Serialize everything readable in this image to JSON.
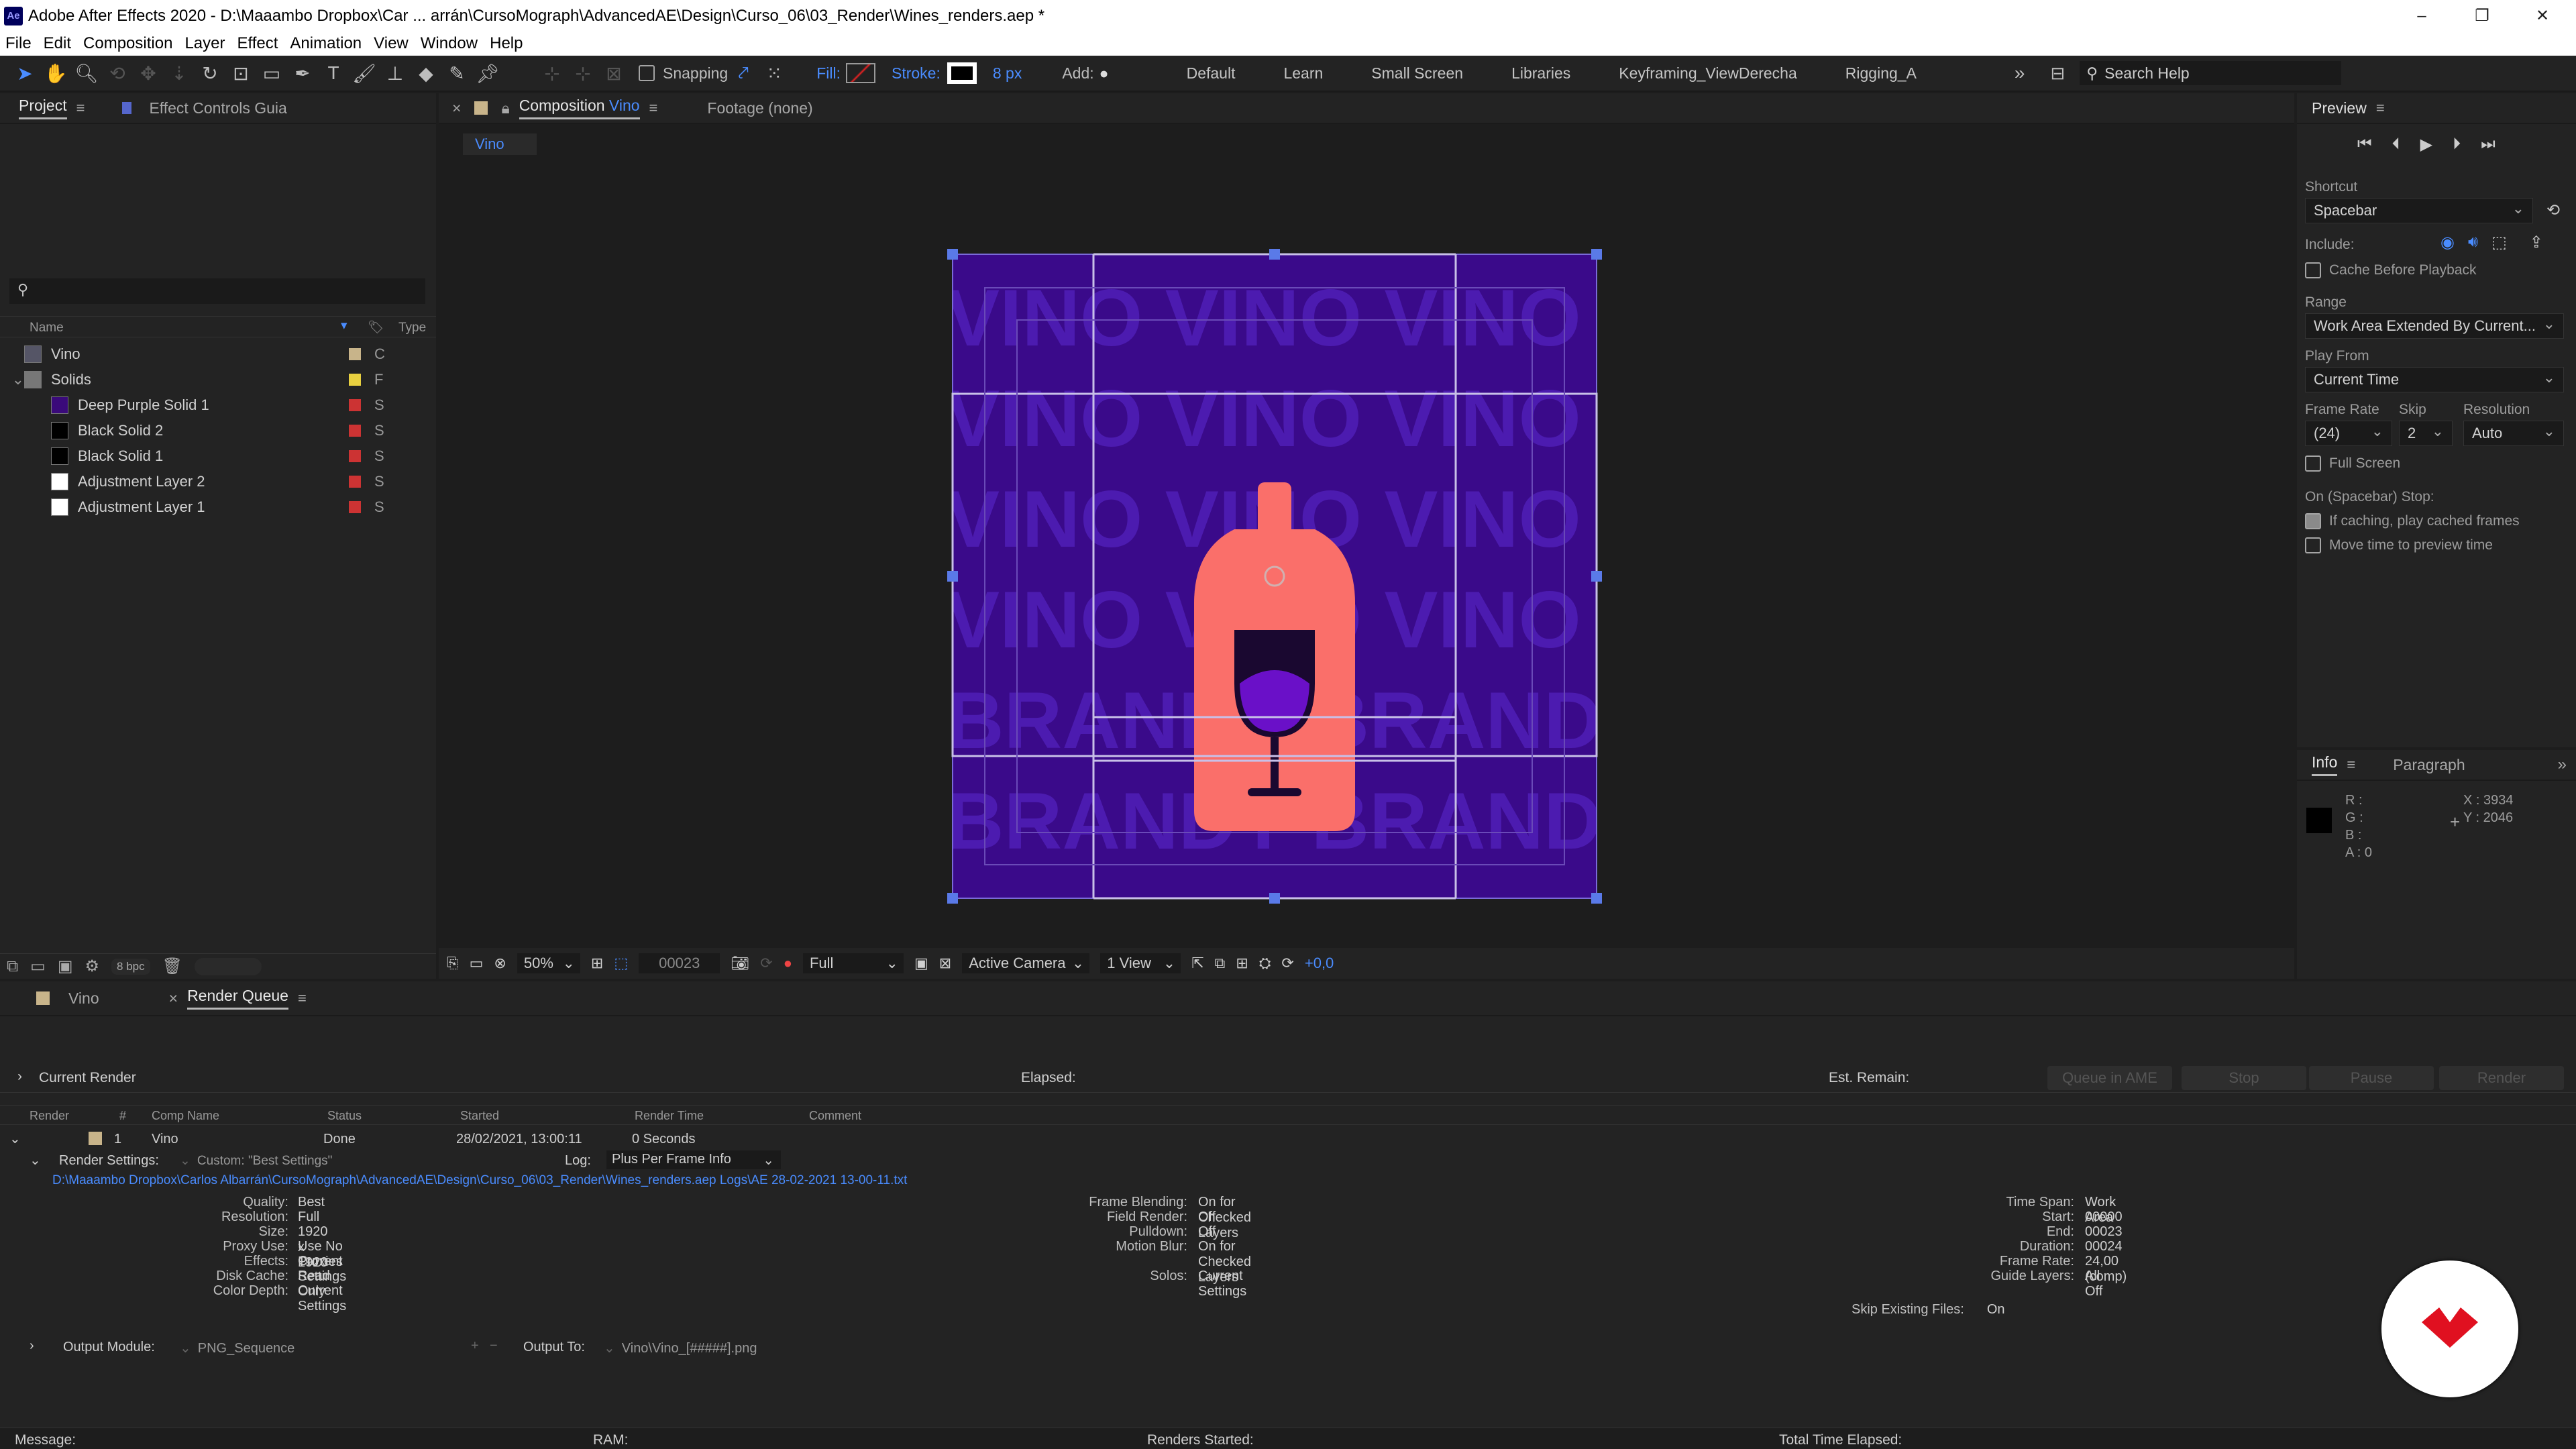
{
  "window": {
    "title": "Adobe After Effects 2020 - D:\\Maaambo Dropbox\\Car ... arrán\\CursoMograph\\AdvancedAE\\Design\\Curso_06\\03_Render\\Wines_renders.aep *",
    "logo": "Ae",
    "minimize": "–",
    "maximize": "❐",
    "close": "✕"
  },
  "menu": [
    "File",
    "Edit",
    "Composition",
    "Layer",
    "Effect",
    "Animation",
    "View",
    "Window",
    "Help"
  ],
  "toolbar": {
    "snapping": "Snapping",
    "fill": "Fill:",
    "stroke": "Stroke:",
    "stroke_px": "8 px",
    "add": "Add:",
    "workspaces": [
      "Default",
      "Learn",
      "Small Screen",
      "Libraries",
      "Keyframing_ViewDerecha",
      "Rigging_A"
    ],
    "more": "»",
    "search_help": "Search Help"
  },
  "project": {
    "tab": "Project",
    "effect_controls": "Effect Controls Guia",
    "col_name": "Name",
    "col_type": "Type",
    "items": [
      {
        "name": "Vino",
        "type": "C",
        "color": "#c8b48a",
        "swatch": "comp",
        "indent": 0
      },
      {
        "name": "Solids",
        "type": "F",
        "color": "#e8d040",
        "swatch": "folder",
        "indent": 0
      },
      {
        "name": "Deep Purple Solid 1",
        "type": "S",
        "color": "#cc3333",
        "swatch": "#3a0a7a",
        "indent": 1
      },
      {
        "name": "Black Solid 2",
        "type": "S",
        "color": "#cc3333",
        "swatch": "#000000",
        "indent": 1
      },
      {
        "name": "Black Solid 1",
        "type": "S",
        "color": "#cc3333",
        "swatch": "#000000",
        "indent": 1
      },
      {
        "name": "Adjustment Layer 2",
        "type": "S",
        "color": "#cc3333",
        "swatch": "#ffffff",
        "indent": 1
      },
      {
        "name": "Adjustment Layer 1",
        "type": "S",
        "color": "#cc3333",
        "swatch": "#ffffff",
        "indent": 1
      }
    ],
    "bpc": "8 bpc"
  },
  "composition": {
    "tab_prefix": "Composition",
    "tab_name": "Vino",
    "footage": "Footage (none)",
    "breadcrumb": "Vino",
    "bg_words": [
      "VINO VINO VINO VINO",
      "VINO VINO VINO VINO",
      "VINO VINO VINO VINO",
      "VINO VINO VINO VINO",
      "BRANDY BRANDY BRA",
      "BRANDY BRANDY BRA"
    ],
    "colors": {
      "bg": "#3a0a8a",
      "text": "#4c1bb0",
      "bottle": "#fa6f6a",
      "wine": "#6a10c8"
    },
    "zoom": "50%",
    "frame": "00023",
    "resolution": "Full",
    "camera": "Active Camera",
    "views": "1 View",
    "exposure": "+0,0"
  },
  "preview": {
    "tab": "Preview",
    "shortcut_label": "Shortcut",
    "shortcut": "Spacebar",
    "include": "Include:",
    "cache_before": "Cache Before Playback",
    "range_label": "Range",
    "range": "Work Area Extended By Current...",
    "play_from_label": "Play From",
    "play_from": "Current Time",
    "frame_rate_label": "Frame Rate",
    "skip_label": "Skip",
    "resolution_label": "Resolution",
    "frame_rate": "(24)",
    "skip": "2",
    "resolution": "Auto",
    "full_screen": "Full Screen",
    "on_stop": "On (Spacebar) Stop:",
    "if_caching": "If caching, play cached frames",
    "move_time": "Move time to preview time"
  },
  "info": {
    "tab": "Info",
    "paragraph": "Paragraph",
    "r": "R :",
    "g": "G :",
    "b": "B :",
    "a": "A :  0",
    "x": "X : 3934",
    "y": "Y : 2046"
  },
  "render_queue": {
    "tab_vino": "Vino",
    "tab_rq": "Render Queue",
    "current_render": "Current Render",
    "elapsed": "Elapsed:",
    "est_remain": "Est. Remain:",
    "buttons": [
      "Queue in AME",
      "Stop",
      "Pause",
      "Render"
    ],
    "columns": [
      "Render",
      "#",
      "Comp Name",
      "Status",
      "Started",
      "Render Time",
      "Comment"
    ],
    "item": {
      "num": "1",
      "comp": "Vino",
      "status": "Done",
      "started": "28/02/2021, 13:00:11",
      "render_time": "0 Seconds"
    },
    "render_settings_label": "Render Settings:",
    "render_settings": "Custom: \"Best Settings\"",
    "log_label": "Log:",
    "log": "Plus Per Frame Info",
    "log_path": "D:\\Maaambo Dropbox\\Carlos Albarrán\\CursoMograph\\AdvancedAE\\Design\\Curso_06\\03_Render\\Wines_renders.aep Logs\\AE 28-02-2021 13-00-11.txt",
    "settings_left": [
      [
        "Quality:",
        "Best"
      ],
      [
        "Resolution:",
        "Full"
      ],
      [
        "Size:",
        "1920 x 1920"
      ],
      [
        "Proxy Use:",
        "Use No Proxies"
      ],
      [
        "Effects:",
        "Current Settings"
      ],
      [
        "Disk Cache:",
        "Read Only"
      ],
      [
        "Color Depth:",
        "Current Settings"
      ]
    ],
    "settings_mid": [
      [
        "Frame Blending:",
        "On for Checked Layers"
      ],
      [
        "Field Render:",
        "Off"
      ],
      [
        "Pulldown:",
        "Off"
      ],
      [
        "Motion Blur:",
        "On for Checked Layers"
      ],
      [
        "",
        ""
      ],
      [
        "Solos:",
        "Current Settings"
      ]
    ],
    "settings_right": [
      [
        "Time Span:",
        "Work Area"
      ],
      [
        "Start:",
        "00000"
      ],
      [
        "End:",
        "00023"
      ],
      [
        "Duration:",
        "00024"
      ],
      [
        "Frame Rate:",
        "24,00 (comp)"
      ],
      [
        "Guide Layers:",
        "All Off"
      ]
    ],
    "skip_existing": [
      "Skip Existing Files:",
      "On"
    ],
    "output_module_label": "Output Module:",
    "output_module": "PNG_Sequence",
    "output_to_label": "Output To:",
    "output_to": "Vino\\Vino_[#####].png"
  },
  "statusbar": {
    "message": "Message:",
    "ram": "RAM:",
    "renders_started": "Renders Started:",
    "total_time": "Total Time Elapsed:"
  }
}
